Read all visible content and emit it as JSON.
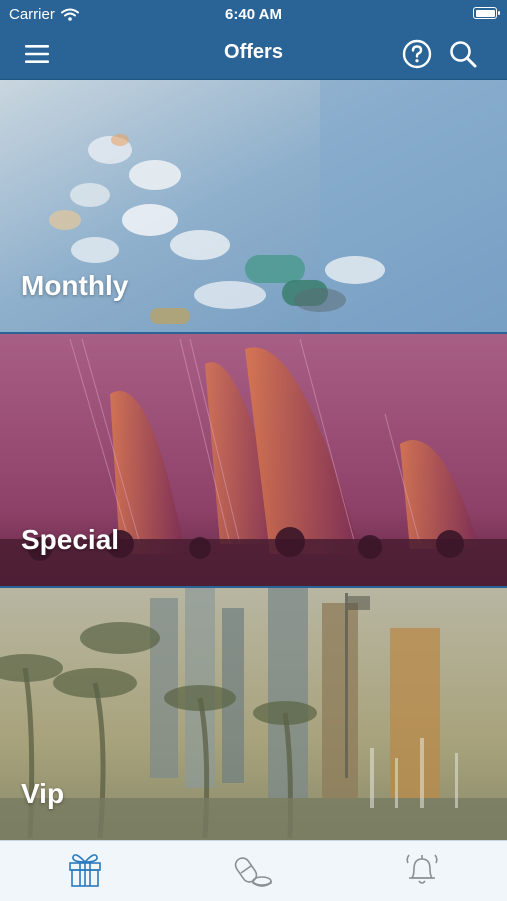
{
  "status_bar": {
    "carrier": "Carrier",
    "time": "6:40 AM",
    "wifi_icon": "wifi-icon",
    "battery_icon": "battery-icon"
  },
  "nav": {
    "title": "Offers",
    "menu_icon": "hamburger-menu-icon",
    "help_icon": "question-circle-icon",
    "search_icon": "search-icon"
  },
  "offers": [
    {
      "label": "Monthly",
      "tint": "#7aa4c4"
    },
    {
      "label": "Special",
      "tint": "#9a4a6e"
    },
    {
      "label": "Vip",
      "tint": "#b7a96a"
    }
  ],
  "tabs": [
    {
      "icon": "gift-icon",
      "active": true
    },
    {
      "icon": "pills-icon",
      "active": false
    },
    {
      "icon": "bell-icon",
      "active": false
    }
  ],
  "colors": {
    "brand": "#2a6496",
    "tab_active": "#2a7bc0",
    "tab_inactive": "#8a8f94"
  }
}
